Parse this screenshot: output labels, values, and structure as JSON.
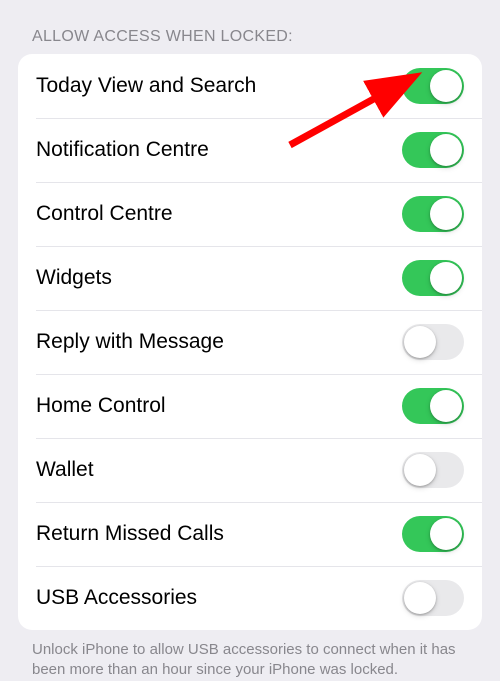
{
  "section_header": "Allow Access When Locked:",
  "rows": [
    {
      "label": "Today View and Search",
      "on": true
    },
    {
      "label": "Notification Centre",
      "on": true
    },
    {
      "label": "Control Centre",
      "on": true
    },
    {
      "label": "Widgets",
      "on": true
    },
    {
      "label": "Reply with Message",
      "on": false
    },
    {
      "label": "Home Control",
      "on": true
    },
    {
      "label": "Wallet",
      "on": false
    },
    {
      "label": "Return Missed Calls",
      "on": true
    },
    {
      "label": "USB Accessories",
      "on": false
    }
  ],
  "footer": "Unlock iPhone to allow USB accessories to connect when it has been more than an hour since your iPhone was locked.",
  "annotation": {
    "type": "arrow",
    "points_to_row": 0,
    "color": "#ff0000"
  }
}
